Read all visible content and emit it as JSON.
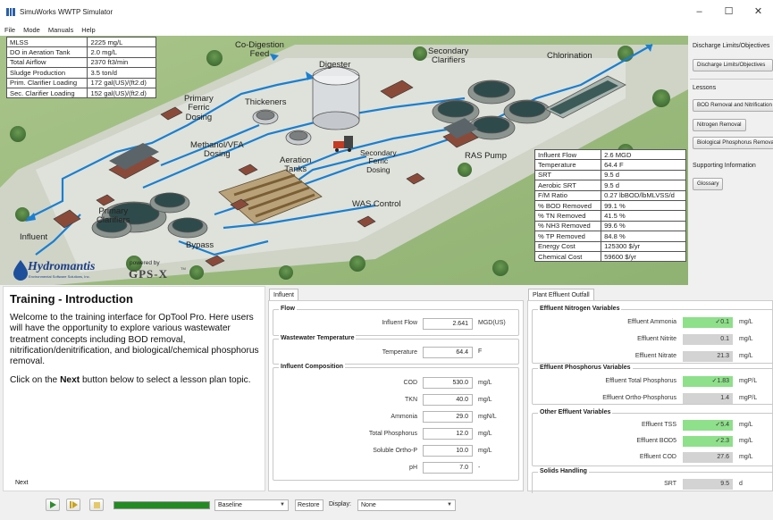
{
  "window": {
    "title": "SimuWorks WWTP Simulator",
    "controls": [
      "–",
      "☐",
      "✕"
    ]
  },
  "menu": [
    "File",
    "Mode",
    "Manuals",
    "Help"
  ],
  "status_table": [
    [
      "MLSS",
      "2225 mg/L"
    ],
    [
      "DO in Aeration Tank",
      "2.0 mg/L"
    ],
    [
      "Total Airflow",
      "2370 ft3/min"
    ],
    [
      "Sludge Production",
      "3.5 ton/d"
    ],
    [
      "Prim. Clarifier Loading",
      "172 gal(US)/(ft2.d)"
    ],
    [
      "Sec. Clarifier Loading",
      "152 gal(US)/(ft2.d)"
    ]
  ],
  "process_table": [
    [
      "Influent Flow",
      "2.6 MGD"
    ],
    [
      "Temperature",
      "64.4 F"
    ],
    [
      "SRT",
      "9.5 d"
    ],
    [
      "Aerobic SRT",
      "9.5 d"
    ],
    [
      "F/M Ratio",
      "0.27 lbBOD/lbMLVSS/d"
    ],
    [
      "% BOD Removed",
      "99.1 %"
    ],
    [
      "% TN Removed",
      "41.5 %"
    ],
    [
      "% NH3 Removed",
      "99.6 %"
    ],
    [
      "% TP Removed",
      "84.8 %"
    ],
    [
      "Energy Cost",
      "125300 $/yr"
    ],
    [
      "Chemical Cost",
      "59600 $/yr"
    ]
  ],
  "diagram_labels": {
    "codigestion": "Co-Digestion\nFeed",
    "digester": "Digester",
    "secondary_clarifiers": "Secondary\nClarifiers",
    "chlorination": "Chlorination",
    "primary_ferric": "Primary\nFerric\nDosing",
    "thickeners": "Thickeners",
    "methanol": "Methanol/VFA\nDosing",
    "aeration": "Aeration\nTanks",
    "secondary_ferric": "Secondary\nFerric\nDosing",
    "ras_pump": "RAS Pump",
    "primary_clarifiers": "Primary\nClarifiers",
    "was_control": "WAS Control",
    "influent": "Influent",
    "bypass": "Bypass"
  },
  "logo": {
    "name": "Hydromantis",
    "tagline": "Environmental Software Solutions, Inc.",
    "powered_by": "powered by",
    "engine": "GPS-X",
    "tm": "TM"
  },
  "sidebar": {
    "discharge_heading": "Discharge Limits/Objectives",
    "discharge_button": "Discharge Limits/Objectives",
    "lessons_heading": "Lessons",
    "lessons": [
      "BOD Removal and Nitrification",
      "Nitrogen Removal",
      "Biological Phosphorus Removal"
    ],
    "supporting_heading": "Supporting Information",
    "glossary": "Glossary"
  },
  "training": {
    "title": "Training - Introduction",
    "para1": "Welcome to the training interface for OpTool Pro. Here users will have the opportunity to explore various wastewater treatment concepts including BOD removal, nitrification/denitrification, and biological/chemical phosphorus removal.",
    "para2_pre": "Click on the ",
    "para2_bold": "Next",
    "para2_post": " button below to select a lesson plan topic.",
    "next": "Next"
  },
  "influent": {
    "tab": "Influent",
    "flow_group": "Flow",
    "flow_label": "Influent Flow",
    "flow_value": "2.641",
    "flow_unit": "MGD(US)",
    "temp_group": "Wastewater Temperature",
    "temp_label": "Temperature",
    "temp_value": "64.4",
    "temp_unit": "F",
    "comp_group": "Influent Composition",
    "composition": [
      {
        "label": "COD",
        "value": "530.0",
        "unit": "mg/L"
      },
      {
        "label": "TKN",
        "value": "40.0",
        "unit": "mg/L"
      },
      {
        "label": "Ammonia",
        "value": "29.0",
        "unit": "mgN/L"
      },
      {
        "label": "Total Phosphorus",
        "value": "12.0",
        "unit": "mg/L"
      },
      {
        "label": "Soluble Ortho-P",
        "value": "10.0",
        "unit": "mg/L"
      },
      {
        "label": "pH",
        "value": "7.0",
        "unit": "-"
      }
    ]
  },
  "effluent": {
    "tab": "Plant Effluent Outfall",
    "nitrogen_group": "Effluent Nitrogen Variables",
    "nitrogen": [
      {
        "label": "Effluent Ammonia",
        "value": "✓0.1",
        "unit": "mg/L",
        "ok": true
      },
      {
        "label": "Effluent Nitrite",
        "value": "0.1",
        "unit": "mg/L",
        "ok": false
      },
      {
        "label": "Effluent Nitrate",
        "value": "21.3",
        "unit": "mg/L",
        "ok": false
      }
    ],
    "phosphorus_group": "Effluent Phosphorus Variables",
    "phosphorus": [
      {
        "label": "Effluent Total Phosphorus",
        "value": "✓1.83",
        "unit": "mgP/L",
        "ok": true
      },
      {
        "label": "Effluent Ortho-Phosphorus",
        "value": "1.4",
        "unit": "mgP/L",
        "ok": false
      }
    ],
    "other_group": "Other Effluent Variables",
    "other": [
      {
        "label": "Effluent TSS",
        "value": "✓5.4",
        "unit": "mg/L",
        "ok": true
      },
      {
        "label": "Effluent BOD5",
        "value": "✓2.3",
        "unit": "mg/L",
        "ok": true
      },
      {
        "label": "Effluent COD",
        "value": "27.6",
        "unit": "mg/L",
        "ok": false
      }
    ],
    "solids_group": "Solids Handling",
    "solids": [
      {
        "label": "SRT",
        "value": "9.5",
        "unit": "d",
        "ok": false
      }
    ]
  },
  "bottombar": {
    "progress": 1.0,
    "scenario": "Baseline",
    "restore": "Restore",
    "display_label": "Display:",
    "display_value": "None"
  },
  "colors": {
    "ok": "#8ee08a",
    "pipe": "#1a7fd1",
    "progress": "#228b22"
  }
}
